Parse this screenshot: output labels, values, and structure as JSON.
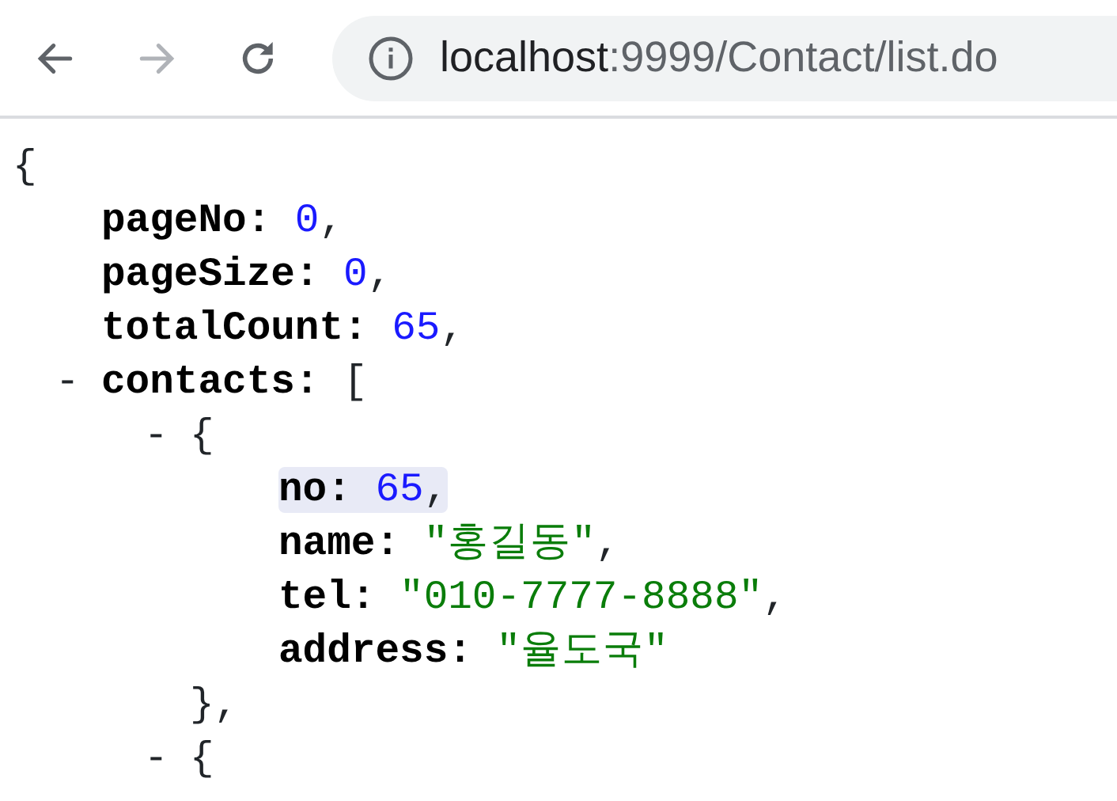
{
  "toolbar": {
    "back": {
      "disabled": false
    },
    "forward": {
      "disabled": true
    },
    "address": {
      "host": "localhost",
      "path": ":9999/Contact/list.do"
    }
  },
  "json_view": {
    "open": "{",
    "children": [
      {
        "key": "pageNo:",
        "value": "0",
        "kind": "number",
        "comma": ",",
        "highlighted": false
      },
      {
        "key": "pageSize:",
        "value": "0",
        "kind": "number",
        "comma": ",",
        "highlighted": false
      },
      {
        "key": "totalCount:",
        "value": "65",
        "kind": "number",
        "comma": ",",
        "highlighted": false
      },
      {
        "toggle": "-",
        "key": "contacts:",
        "open": "[",
        "children": [
          {
            "toggle": "-",
            "open": "{",
            "close": "},",
            "children": [
              {
                "key": "no:",
                "value": "65",
                "kind": "number",
                "comma": ",",
                "highlighted": true
              },
              {
                "key": "name:",
                "value": "\"홍길동\"",
                "kind": "string",
                "comma": ",",
                "highlighted": false
              },
              {
                "key": "tel:",
                "value": "\"010-7777-8888\"",
                "kind": "string",
                "comma": ",",
                "highlighted": false
              },
              {
                "key": "address:",
                "value": "\"율도국\"",
                "kind": "string",
                "highlighted": false
              }
            ]
          },
          {
            "toggle": "-",
            "open": "{"
          }
        ]
      }
    ]
  }
}
